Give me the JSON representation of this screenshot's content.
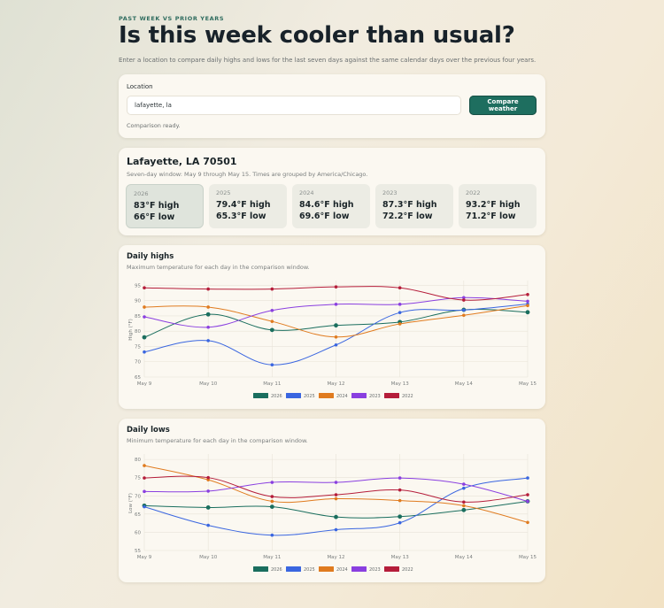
{
  "header": {
    "eyebrow": "PAST WEEK VS PRIOR YEARS",
    "title": "Is this week cooler than usual?",
    "subtitle": "Enter a location to compare daily highs and lows for the last seven days against the same calendar days over the previous four years."
  },
  "search": {
    "label": "Location",
    "value": "lafayette, la",
    "button": "Compare weather",
    "status": "Comparison ready."
  },
  "summary": {
    "place": "Lafayette, LA 70501",
    "window": "Seven-day window: May 9 through May 15. Times are grouped by America/Chicago.",
    "years": [
      {
        "year": "2026",
        "high": "83°F high",
        "low": "66°F low"
      },
      {
        "year": "2025",
        "high": "79.4°F high",
        "low": "65.3°F low"
      },
      {
        "year": "2024",
        "high": "84.6°F high",
        "low": "69.6°F low"
      },
      {
        "year": "2023",
        "high": "87.3°F high",
        "low": "72.2°F low"
      },
      {
        "year": "2022",
        "high": "93.2°F high",
        "low": "71.2°F low"
      }
    ]
  },
  "highs_card": {
    "title": "Daily highs",
    "subtitle": "Maximum temperature for each day in the comparison window."
  },
  "lows_card": {
    "title": "Daily lows",
    "subtitle": "Minimum temperature for each day in the comparison window."
  },
  "colors": {
    "2026": "#1a6e5e",
    "2025": "#3a66e0",
    "2024": "#e07b1f",
    "2023": "#8a3fe0",
    "2022": "#b51d3a"
  },
  "chart_data": [
    {
      "type": "line",
      "ylabel": "High (°F)",
      "x": [
        "May 9",
        "May 10",
        "May 11",
        "May 12",
        "May 13",
        "May 14",
        "May 15"
      ],
      "yticks": [
        65,
        70,
        75,
        80,
        85,
        90,
        95
      ],
      "ylim": [
        65,
        96
      ],
      "grid": true,
      "legend": "bottom",
      "series": [
        {
          "name": "2026",
          "values": [
            78.0,
            85.5,
            80.4,
            81.9,
            83.0,
            87.0,
            86.2
          ]
        },
        {
          "name": "2025",
          "values": [
            73.2,
            76.9,
            69.0,
            75.5,
            86.1,
            86.9,
            88.9
          ]
        },
        {
          "name": "2024",
          "values": [
            87.9,
            87.9,
            83.2,
            78.1,
            82.4,
            85.2,
            88.4
          ]
        },
        {
          "name": "2023",
          "values": [
            84.7,
            81.3,
            86.8,
            88.8,
            88.8,
            91.0,
            89.8
          ]
        },
        {
          "name": "2022",
          "values": [
            94.2,
            93.8,
            93.8,
            94.5,
            94.2,
            90.2,
            92.0
          ]
        }
      ]
    },
    {
      "type": "line",
      "ylabel": "Low (°F)",
      "x": [
        "May 9",
        "May 10",
        "May 11",
        "May 12",
        "May 13",
        "May 14",
        "May 15"
      ],
      "yticks": [
        55,
        60,
        65,
        70,
        75,
        80
      ],
      "ylim": [
        55,
        81
      ],
      "grid": true,
      "legend": "bottom",
      "series": [
        {
          "name": "2026",
          "values": [
            67.3,
            66.8,
            67.0,
            64.2,
            64.3,
            66.1,
            68.5
          ]
        },
        {
          "name": "2025",
          "values": [
            67.0,
            61.9,
            59.2,
            60.7,
            62.6,
            72.1,
            74.9
          ]
        },
        {
          "name": "2024",
          "values": [
            78.3,
            74.4,
            68.5,
            69.2,
            68.7,
            67.3,
            62.7
          ]
        },
        {
          "name": "2023",
          "values": [
            71.2,
            71.3,
            73.7,
            73.7,
            74.9,
            73.2,
            68.5
          ]
        },
        {
          "name": "2022",
          "values": [
            74.9,
            75.0,
            69.8,
            70.3,
            71.6,
            68.3,
            70.3
          ]
        }
      ]
    }
  ]
}
